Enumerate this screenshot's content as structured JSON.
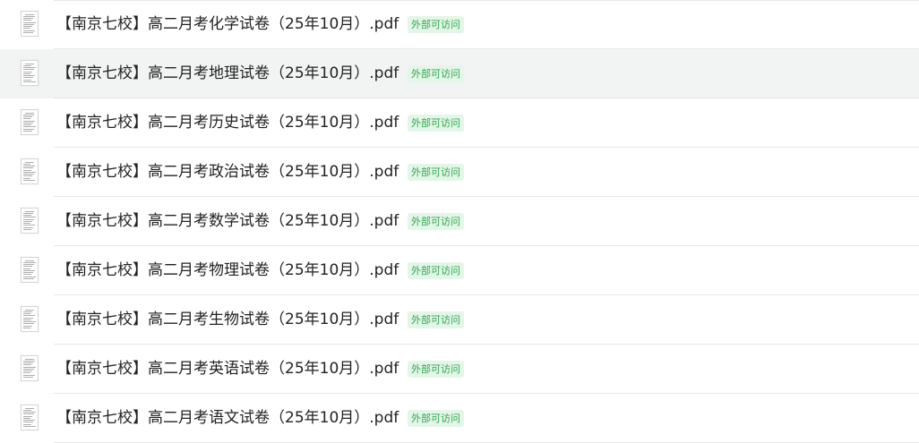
{
  "files": [
    {
      "name": "【南京七校】高二月考化学试卷（25年10月）.pdf",
      "badge": "外部可访问",
      "icon": "pdf-thumbnail-icon"
    },
    {
      "name": "【南京七校】高二月考地理试卷（25年10月）.pdf",
      "badge": "外部可访问",
      "icon": "pdf-thumbnail-icon"
    },
    {
      "name": "【南京七校】高二月考历史试卷（25年10月）.pdf",
      "badge": "外部可访问",
      "icon": "pdf-thumbnail-icon"
    },
    {
      "name": "【南京七校】高二月考政治试卷（25年10月）.pdf",
      "badge": "外部可访问",
      "icon": "pdf-thumbnail-icon"
    },
    {
      "name": "【南京七校】高二月考数学试卷（25年10月）.pdf",
      "badge": "外部可访问",
      "icon": "pdf-thumbnail-icon"
    },
    {
      "name": "【南京七校】高二月考物理试卷（25年10月）.pdf",
      "badge": "外部可访问",
      "icon": "pdf-thumbnail-icon"
    },
    {
      "name": "【南京七校】高二月考生物试卷（25年10月）.pdf",
      "badge": "外部可访问",
      "icon": "pdf-thumbnail-icon"
    },
    {
      "name": "【南京七校】高二月考英语试卷（25年10月）.pdf",
      "badge": "外部可访问",
      "icon": "pdf-thumbnail-icon"
    },
    {
      "name": "【南京七校】高二月考语文试卷（25年10月）.pdf",
      "badge": "外部可访问",
      "icon": "pdf-thumbnail-icon"
    }
  ],
  "hovered_index": 1,
  "colors": {
    "badge_text": "#2fa84f",
    "badge_bg": "#e3f6e7",
    "hover_row": "#f2f4f3",
    "divider": "#e8e8e8"
  }
}
